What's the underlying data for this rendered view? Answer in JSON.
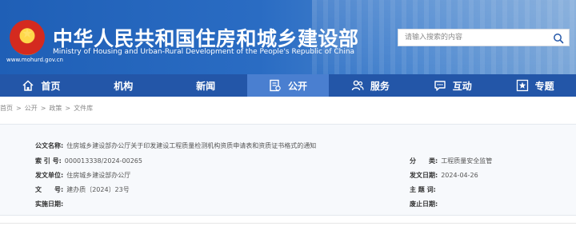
{
  "header": {
    "title": "中华人民共和国住房和城乡建设部",
    "subtitle": "Ministry of Housing and Urban-Rural Development of the People's Republic of China",
    "domain": "www.mohurd.gov.cn",
    "search_placeholder": "请输入搜索的内容"
  },
  "nav": {
    "items": [
      {
        "label": "首页",
        "icon": "home-icon"
      },
      {
        "label": "机构",
        "icon": ""
      },
      {
        "label": "新闻",
        "icon": ""
      },
      {
        "label": "公开",
        "icon": "document-icon",
        "active": true
      },
      {
        "label": "服务",
        "icon": "people-icon"
      },
      {
        "label": "互动",
        "icon": "chat-icon"
      },
      {
        "label": "专题",
        "icon": "star-icon"
      }
    ]
  },
  "breadcrumb": [
    "首页",
    ">",
    "公开",
    ">",
    "政策",
    ">",
    "文件库"
  ],
  "doc": {
    "title_label": "公文名称:",
    "title_value": "住房城乡建设部办公厅关于印发建设工程质量检测机构资质申请表和资质证书格式的通知",
    "index_label": "索 引 号:",
    "index_value": "000013338/2024-00265",
    "category_label": "分　　类:",
    "category_value": "工程质量安全监管",
    "issuer_label": "发文单位:",
    "issuer_value": "住房城乡建设部办公厅",
    "date_label": "发文日期:",
    "date_value": "2024-04-26",
    "number_label": "文　　号:",
    "number_value": "建办质〔2024〕23号",
    "keywords_label": "主 题 词:",
    "keywords_value": "",
    "effective_label": "实施日期:",
    "effective_value": "",
    "expiry_label": "废止日期:",
    "expiry_value": ""
  },
  "colors": {
    "nav_bg": "#2356a8",
    "nav_active": "#4a7fd0",
    "header_bg": "#1f5fb6"
  }
}
